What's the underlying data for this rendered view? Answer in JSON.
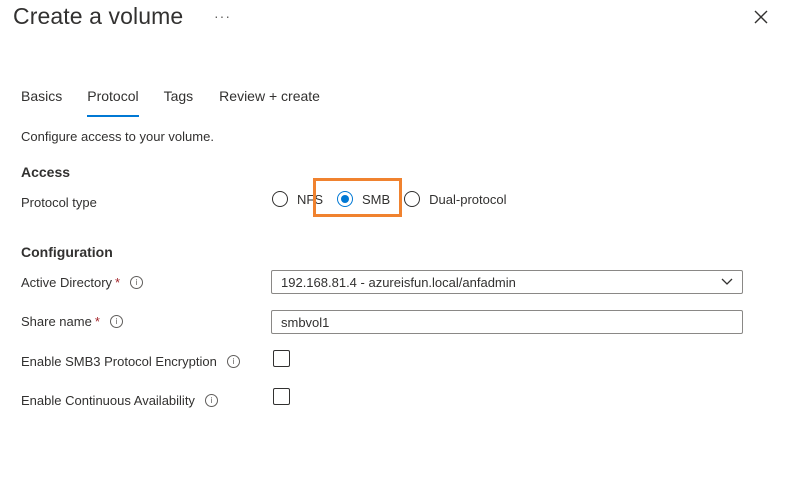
{
  "header": {
    "title": "Create a volume",
    "more_label": "···"
  },
  "tabs": [
    {
      "label": "Basics",
      "active": false
    },
    {
      "label": "Protocol",
      "active": true
    },
    {
      "label": "Tags",
      "active": false
    },
    {
      "label": "Review + create",
      "active": false
    }
  ],
  "intro": "Configure access to your volume.",
  "access": {
    "heading": "Access",
    "protocol_label": "Protocol type",
    "options": [
      {
        "label": "NFS",
        "checked": false
      },
      {
        "label": "SMB",
        "checked": true
      },
      {
        "label": "Dual-protocol",
        "checked": false
      }
    ]
  },
  "configuration": {
    "heading": "Configuration",
    "active_directory": {
      "label": "Active Directory",
      "required_mark": "*",
      "value": "192.168.81.4 - azureisfun.local/anfadmin"
    },
    "share_name": {
      "label": "Share name",
      "required_mark": "*",
      "value": "smbvol1"
    },
    "smb3_encryption": {
      "label": "Enable SMB3 Protocol Encryption",
      "checked": false
    },
    "continuous_availability": {
      "label": "Enable Continuous Availability",
      "checked": false
    }
  },
  "info_glyph": "i",
  "colors": {
    "accent": "#0078d4",
    "highlight": "#f0822f",
    "required": "#a4262c"
  }
}
